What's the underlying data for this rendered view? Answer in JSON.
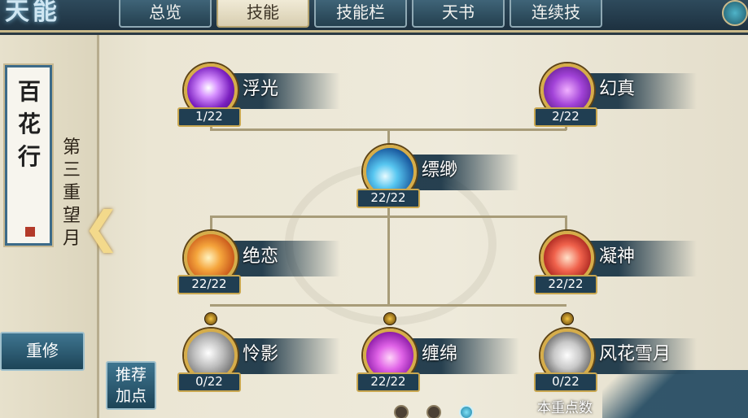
{
  "logo_text": "天能",
  "tabs": [
    {
      "label": "总览",
      "active": false
    },
    {
      "label": "技能",
      "active": true
    },
    {
      "label": "技能栏",
      "active": false
    },
    {
      "label": "天书",
      "active": false
    },
    {
      "label": "连续技",
      "active": false
    }
  ],
  "school": {
    "name": "百花行",
    "tier_title": "第三重望月"
  },
  "buttons": {
    "reset": "重修",
    "recommend_line1": "推荐",
    "recommend_line2": "加点"
  },
  "skills": [
    {
      "name": "浮光",
      "level": "1/22",
      "icon": "violet-burst-icon"
    },
    {
      "name": "幻真",
      "level": "2/22",
      "icon": "purple-crystal-icon"
    },
    {
      "name": "缥缈",
      "level": "22/22",
      "icon": "blue-wave-icon"
    },
    {
      "name": "绝恋",
      "level": "22/22",
      "icon": "orange-sword-icon"
    },
    {
      "name": "凝神",
      "level": "22/22",
      "icon": "red-blade-icon"
    },
    {
      "name": "怜影",
      "level": "0/22",
      "icon": "grey-swirl-icon"
    },
    {
      "name": "缠绵",
      "level": "22/22",
      "icon": "magenta-flame-icon"
    },
    {
      "name": "风花雪月",
      "level": "0/22",
      "icon": "moon-icon"
    }
  ],
  "footer": {
    "points_label": "本重点数"
  },
  "pagination": {
    "pages": 3,
    "current": 3
  },
  "colors": {
    "accent_gold": "#d6ad4a",
    "panel_blue": "#203e52",
    "parchment": "#ebe6d4"
  }
}
